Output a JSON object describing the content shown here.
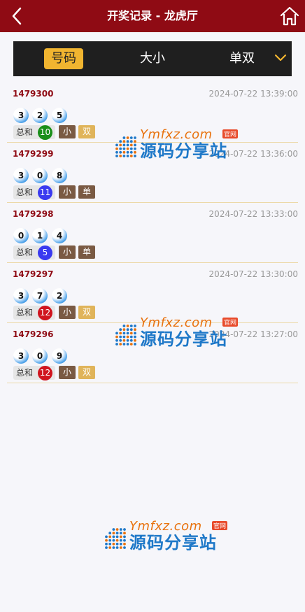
{
  "header": {
    "title": "开奖记录 - 龙虎厅"
  },
  "tabs": [
    "号码",
    "大小",
    "单双"
  ],
  "colors": {
    "brand": "#8f0b14",
    "tab_active": "#f1b530",
    "ball_blue": "#4ea3ea",
    "green": "#1a8f1a",
    "blue": "#3a3af0",
    "red": "#d0141e",
    "tag_brown": "#7a5a43",
    "tag_gold": "#e0b45a"
  },
  "records": [
    {
      "issue": "1479300",
      "time": "2024-07-22 13:39:00",
      "balls": [
        "3",
        "2",
        "5"
      ],
      "sum_label": "总和",
      "sum": "10",
      "sum_color": "#1a8f1a",
      "size": "小",
      "oe": "双",
      "oe_color": "#e0b45a"
    },
    {
      "issue": "1479299",
      "time": "2024-07-22 13:36:00",
      "balls": [
        "3",
        "0",
        "8"
      ],
      "sum_label": "总和",
      "sum": "11",
      "sum_color": "#3a3af0",
      "size": "小",
      "oe": "单",
      "oe_color": "#7a5a43"
    },
    {
      "issue": "1479298",
      "time": "2024-07-22 13:33:00",
      "balls": [
        "0",
        "1",
        "4"
      ],
      "sum_label": "总和",
      "sum": "5",
      "sum_color": "#3a3af0",
      "size": "小",
      "oe": "单",
      "oe_color": "#7a5a43"
    },
    {
      "issue": "1479297",
      "time": "2024-07-22 13:30:00",
      "balls": [
        "3",
        "7",
        "2"
      ],
      "sum_label": "总和",
      "sum": "12",
      "sum_color": "#d0141e",
      "size": "小",
      "oe": "双",
      "oe_color": "#e0b45a"
    },
    {
      "issue": "1479296",
      "time": "2024-07-22 13:27:00",
      "balls": [
        "3",
        "0",
        "9"
      ],
      "sum_label": "总和",
      "sum": "12",
      "sum_color": "#d0141e",
      "size": "小",
      "oe": "双",
      "oe_color": "#e0b45a"
    }
  ],
  "watermark": {
    "domain": "Ymfxz.com",
    "badge": "官网",
    "name": "源码分享站"
  }
}
